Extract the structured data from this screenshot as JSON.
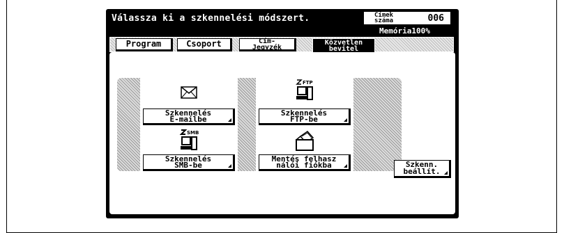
{
  "header": {
    "title": "Válassza ki a szkennelési módszert.",
    "count_label": "Címek\nszáma",
    "count_value": "006",
    "memory": "Memória100%"
  },
  "tabs": [
    {
      "label": "Program"
    },
    {
      "label": "Csoport"
    },
    {
      "label": "Cím-\nJegyzék"
    },
    {
      "label": "Közvetlen\nbevitel"
    }
  ],
  "options": {
    "email": {
      "label": "Szkennelés\nE-mailbe",
      "icon": "envelope-icon"
    },
    "ftp": {
      "label": "Szkennelés\nFTP-be",
      "icon": "ftp-computer-icon",
      "icon_text": "FTP"
    },
    "smb": {
      "label": "Szkennelés\nSMB-be",
      "icon": "smb-computer-icon",
      "icon_text": "SMB"
    },
    "box": {
      "label": "Mentés felhasz\nnálói fiókba",
      "icon": "user-box-icon"
    }
  },
  "settings_button": {
    "label": "Szkenn.\nbeállít."
  }
}
